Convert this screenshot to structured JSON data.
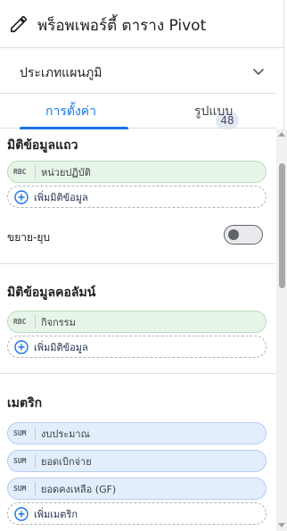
{
  "header": {
    "title": "พร็อพเพอร์ตี้ ตาราง Pivot",
    "icon": "pencil-icon"
  },
  "chart_type": {
    "label": "ประเภทแผนภูมิ",
    "badge": "48",
    "icon": "chevron-down-icon"
  },
  "tabs": [
    {
      "label": "การตั้งค่า",
      "active": true
    },
    {
      "label": "รูปแบบ",
      "active": false
    }
  ],
  "row_dimension": {
    "title": "มิติข้อมูลแถว",
    "chips": [
      {
        "tag": "RBC",
        "label": "หน่วยปฏิบัติ"
      }
    ],
    "add_label": "เพิ่มมิติข้อมูล",
    "expand_label": "ขยาย-ยุบ",
    "expand_enabled": false
  },
  "column_dimension": {
    "title": "มิติข้อมูลคอลัมน์",
    "chips": [
      {
        "tag": "RBC",
        "label": "กิจกรรม"
      }
    ],
    "add_label": "เพิ่มมิติข้อมูล"
  },
  "metrics": {
    "title": "เมตริก",
    "chips": [
      {
        "tag": "SUM",
        "label": "งบประมาณ"
      },
      {
        "tag": "SUM",
        "label": "ยอดเบิกจ่าย"
      },
      {
        "tag": "SUM",
        "label": "ยอดคงเหลือ (GF)"
      }
    ],
    "add_label": "เพิ่มเมตริก"
  },
  "colors": {
    "accent": "#1a73e8",
    "dimension_chip": "#e7f5e9",
    "metric_chip": "#e3eefc"
  }
}
